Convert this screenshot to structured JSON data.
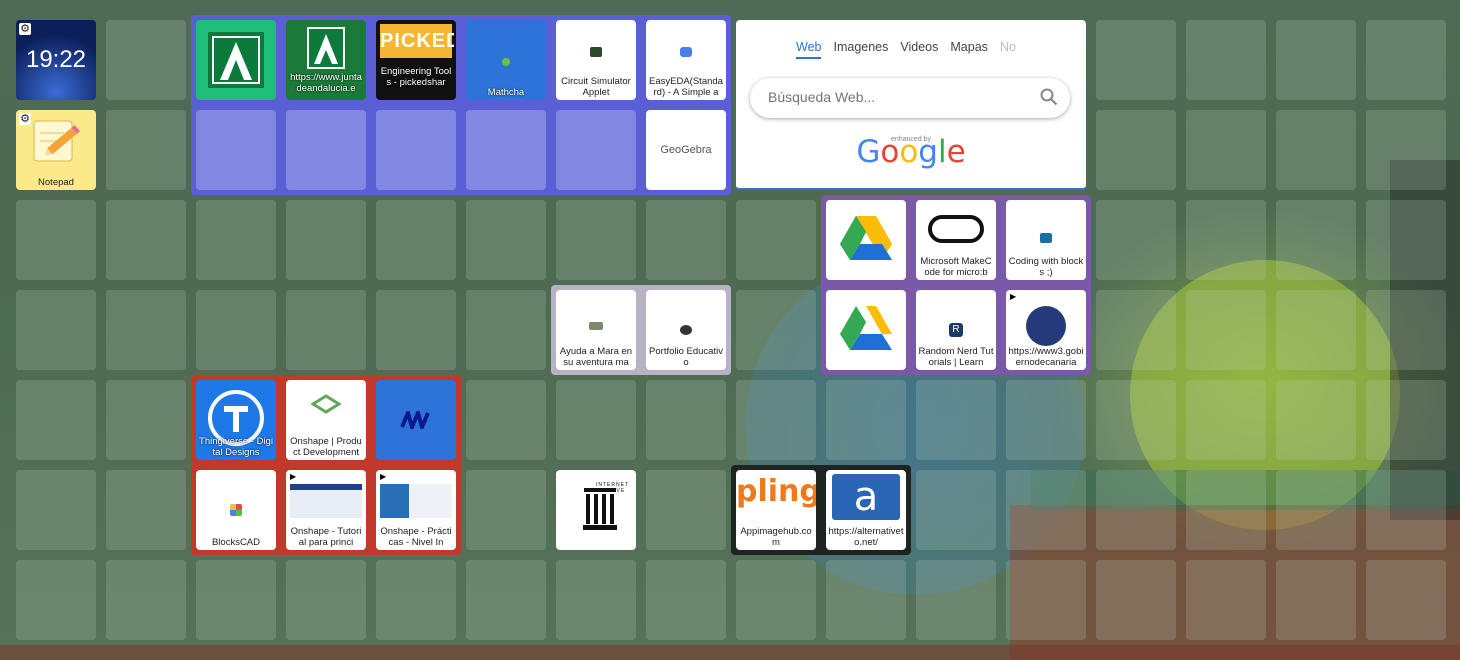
{
  "clock": {
    "time": "19:22"
  },
  "notepad": {
    "label": "Notepad"
  },
  "search": {
    "tabs": [
      "Web",
      "Imagenes",
      "Videos",
      "Mapas",
      "No"
    ],
    "placeholder": "Búsqueda Web...",
    "enhanced_by": "enhanced by",
    "brand": "Google"
  },
  "colors": {
    "blue_group": "#5a5fd6",
    "purple_group": "#7a5aa8",
    "gray_group": "#b9b2c4",
    "red_group": "#c0392b",
    "black_group": "#1e2420"
  },
  "tiles": {
    "junta1": {
      "label": ""
    },
    "junta2": {
      "label": "https://www.juntadeandalucia.e"
    },
    "picked": {
      "label": "Engineering Tools - pickedshar",
      "logo": "PICKED"
    },
    "mathcha": {
      "label": "Mathcha"
    },
    "circuit": {
      "label": "Circuit Simulator Applet"
    },
    "easyeda": {
      "label": "EasyEDA(Standard) - A Simple a"
    },
    "geogebra": {
      "label": "GeoGebra"
    },
    "drive1": {
      "label": ""
    },
    "makecode": {
      "label": "Microsoft MakeCode for micro:b"
    },
    "coding": {
      "label": "Coding with blocks ;)"
    },
    "ayuda": {
      "label": "Ayuda a Mara en su aventura ma"
    },
    "portfolio": {
      "label": "Portfolio Educativo"
    },
    "drive2": {
      "label": ""
    },
    "randomnerd": {
      "label": "Random Nerd Tutorials | Learn"
    },
    "gobcanarias": {
      "label": "https://www3.gobiernodecanaria"
    },
    "thingiverse": {
      "label": "Thingiverse - Digital Designs"
    },
    "onshape1": {
      "label": "Onshape | Product Development"
    },
    "miro": {
      "label": ""
    },
    "blockscad": {
      "label": "BlocksCAD"
    },
    "onshape2": {
      "label": "Onshape - Tutorial para princi"
    },
    "onshape3": {
      "label": "Onshape - Prácticas - Nivel In"
    },
    "archive": {
      "label": "",
      "logo": "INTERNET ARCHIVE"
    },
    "pling": {
      "label": "Appimagehub.com",
      "logo": "pling"
    },
    "alternativeto": {
      "label": "https://alternativeto.net/",
      "logo": "a"
    }
  }
}
